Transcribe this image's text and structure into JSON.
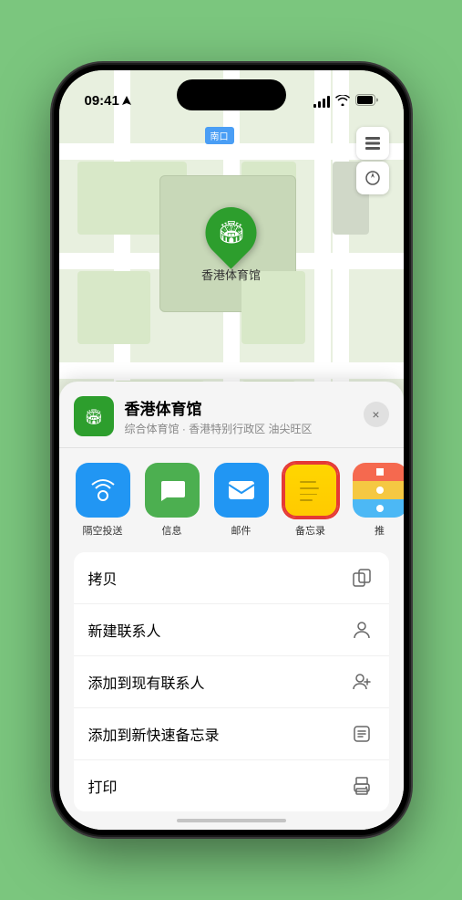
{
  "status_bar": {
    "time": "09:41",
    "location_arrow": "▶"
  },
  "map": {
    "label": "南口",
    "pin_label": "香港体育馆"
  },
  "location_card": {
    "name": "香港体育馆",
    "subtitle": "综合体育馆 · 香港特别行政区 油尖旺区",
    "close_label": "×"
  },
  "share_actions": [
    {
      "id": "airdrop",
      "label": "隔空投送",
      "type": "airdrop"
    },
    {
      "id": "messages",
      "label": "信息",
      "type": "messages"
    },
    {
      "id": "mail",
      "label": "邮件",
      "type": "mail"
    },
    {
      "id": "notes",
      "label": "备忘录",
      "type": "notes"
    },
    {
      "id": "more",
      "label": "推",
      "type": "more"
    }
  ],
  "action_items": [
    {
      "id": "copy",
      "label": "拷贝",
      "icon": "copy"
    },
    {
      "id": "new-contact",
      "label": "新建联系人",
      "icon": "person"
    },
    {
      "id": "add-existing",
      "label": "添加到现有联系人",
      "icon": "person-add"
    },
    {
      "id": "add-notes",
      "label": "添加到新快速备忘录",
      "icon": "notes"
    },
    {
      "id": "print",
      "label": "打印",
      "icon": "print"
    }
  ],
  "colors": {
    "green": "#2d9e2d",
    "blue": "#2196f3",
    "red_border": "#e53935",
    "notes_yellow": "#ffd600"
  }
}
